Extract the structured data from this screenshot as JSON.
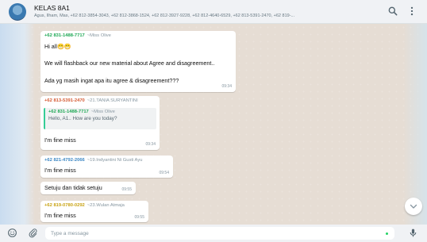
{
  "header": {
    "title": "KELAS 8A1",
    "members": "Agus, Ilham, Mas, +62 812-3854-3043, +62 812-3868-1524, +62 812-3927-9228, +62 812-4640-6529, +62 813-5391-2470, +62 819-..."
  },
  "messages": [
    {
      "phone": "+62 831-1488-7717",
      "name": "~Miss Olive",
      "sender_color": "#1fa855",
      "line1": "Hi all",
      "emoji": "😁😁",
      "line2": "We will flashback our new material about Agree and disagreement..",
      "line3": "Ada yg masih ingat apa itu agree & disagreement???",
      "time": "09:34"
    },
    {
      "phone": "+62 813-5391-2470",
      "name": "~21.TANIA SURYANTINI",
      "sender_color": "#d55b34",
      "quote_phone": "+62 831-1488-7717",
      "quote_name": "~Miss Olive",
      "quote_text": "Hello, A1.. How are you today?",
      "text": "I'm fine miss",
      "time": "09:34"
    },
    {
      "phone": "+62 821-4792-2066",
      "name": "~19.Indyantini Ni Gusti Ayu",
      "sender_color": "#3e88c4",
      "text": "I'm fine miss",
      "time": "09:54"
    },
    {
      "text": "Setuju dan tidak setuju",
      "time": "09:55"
    },
    {
      "phone": "+62 819-0780-0292",
      "name": "~23.Wulan Atmaja",
      "sender_color": "#c8a212",
      "text": "I'm fine miss",
      "time": "09:55"
    }
  ],
  "composer": {
    "placeholder": "Type a message"
  },
  "icons": {
    "search": "search-icon",
    "menu": "more-vertical-icon",
    "emoji": "emoji-icon",
    "attach": "paperclip-icon",
    "mic": "microphone-icon",
    "scroll": "chevron-down-icon"
  }
}
